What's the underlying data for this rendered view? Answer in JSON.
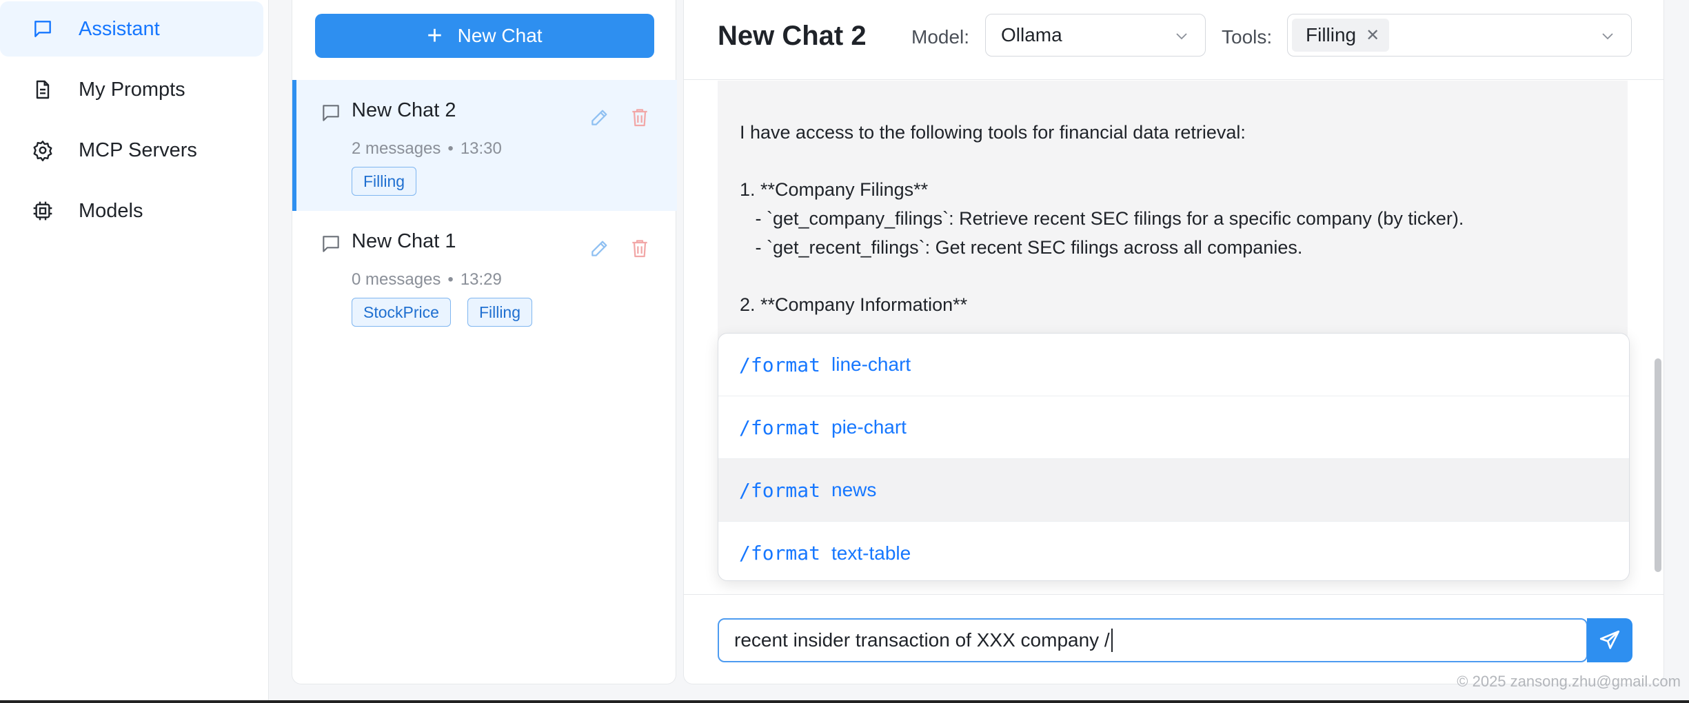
{
  "nav": {
    "items": [
      {
        "label": "Assistant",
        "icon": "chat-bubble-icon",
        "active": true
      },
      {
        "label": "My Prompts",
        "icon": "document-icon"
      },
      {
        "label": "MCP Servers",
        "icon": "gear-icon"
      },
      {
        "label": "Models",
        "icon": "chip-icon"
      }
    ]
  },
  "chat_list": {
    "new_chat_label": "New Chat",
    "chats": [
      {
        "title": "New Chat 2",
        "messages": "2 messages",
        "time": "13:30",
        "tags": [
          "Filling"
        ],
        "active": true
      },
      {
        "title": "New Chat 1",
        "messages": "0 messages",
        "time": "13:29",
        "tags": [
          "StockPrice",
          "Filling"
        ]
      }
    ]
  },
  "header": {
    "title": "New Chat 2",
    "model_label": "Model:",
    "model_value": "Ollama",
    "tools_label": "Tools:",
    "tools_selected": [
      "Filling"
    ]
  },
  "message": {
    "lines": [
      "I have access to the following tools for financial data retrieval:",
      "1. **Company Filings**",
      "   - `get_company_filings`: Retrieve recent SEC filings for a specific company (by ticker).",
      "   - `get_recent_filings`: Get recent SEC filings across all companies.",
      "2. **Company Information**"
    ]
  },
  "format_menu": {
    "items": [
      {
        "command": "/format",
        "arg": "line-chart"
      },
      {
        "command": "/format",
        "arg": "pie-chart"
      },
      {
        "command": "/format",
        "arg": "news",
        "highlighted": true
      },
      {
        "command": "/format",
        "arg": "text-table"
      }
    ]
  },
  "composer": {
    "value": "recent insider transaction of XXX company /"
  },
  "footer": {
    "text": "© 2025 zansong.zhu@gmail.com"
  },
  "colors": {
    "accent": "#2e8ff0",
    "active_bg": "#eef6ff",
    "tag_border": "#7fb6f0",
    "delete_icon": "#f2a7a7"
  }
}
